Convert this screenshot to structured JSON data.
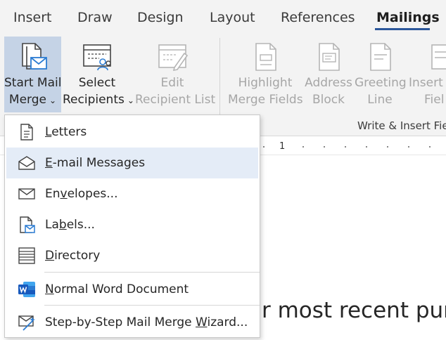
{
  "tabs": [
    {
      "label": "Insert"
    },
    {
      "label": "Draw"
    },
    {
      "label": "Design"
    },
    {
      "label": "Layout"
    },
    {
      "label": "References"
    },
    {
      "label": "Mailings"
    }
  ],
  "ribbon": {
    "start_mail_merge": {
      "line1": "Start Mail",
      "line2": "Merge",
      "icon": "mail-merge-doc-icon"
    },
    "select_recipients": {
      "line1": "Select",
      "line2": "Recipients",
      "icon": "recipients-list-icon"
    },
    "edit_recipient_list": {
      "line1": "Edit",
      "line2": "Recipient List",
      "icon": "edit-list-icon"
    },
    "highlight_merge_fields": {
      "line1": "Highlight",
      "line2": "Merge Fields"
    },
    "address_block": {
      "line1": "Address",
      "line2": "Block"
    },
    "greeting_line": {
      "line1": "Greeting",
      "line2": "Line"
    },
    "insert_merge_field": {
      "line1": "Insert M",
      "line2": "Fiel"
    },
    "group_label": "Write & Insert Fiel"
  },
  "ruler": {
    "number": "1"
  },
  "document": {
    "visible_text": "r most recent purc"
  },
  "menu": {
    "items": [
      {
        "pre": "",
        "key": "L",
        "post": "etters",
        "icon": "letter-icon"
      },
      {
        "pre": "",
        "key": "E",
        "post": "-mail Messages",
        "icon": "email-envelope-icon"
      },
      {
        "pre": "En",
        "key": "v",
        "post": "elopes...",
        "icon": "envelope-icon"
      },
      {
        "pre": "La",
        "key": "b",
        "post": "els...",
        "icon": "labels-icon"
      },
      {
        "pre": "",
        "key": "D",
        "post": "irectory",
        "icon": "directory-icon"
      },
      {
        "pre": "",
        "key": "N",
        "post": "ormal Word Document",
        "icon": "word-icon"
      },
      {
        "pre": "Step-by-Step Mail Merge ",
        "key": "W",
        "post": "izard...",
        "icon": "wizard-icon"
      }
    ]
  },
  "colors": {
    "accent": "#2b579a",
    "pressed": "#c5d3e6",
    "hover": "#e4ecf7",
    "ribbon_bg": "#f3f3f3",
    "icon_blue": "#2b7cd3"
  }
}
